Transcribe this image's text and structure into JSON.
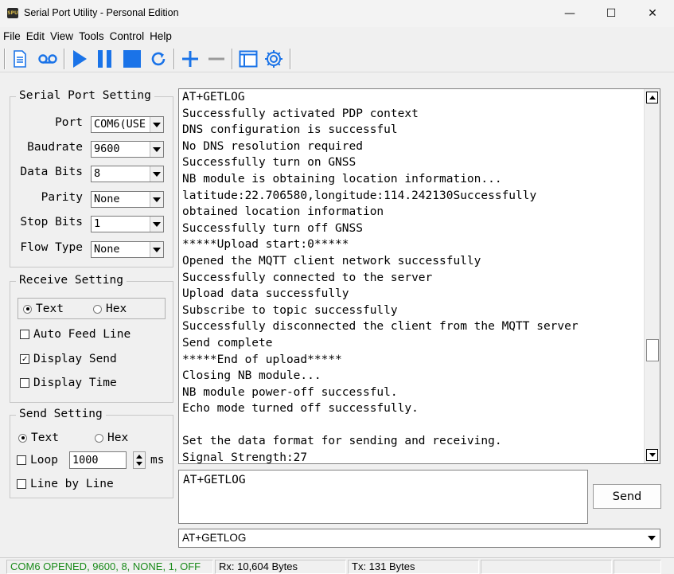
{
  "window": {
    "title": "Serial Port Utility - Personal Edition",
    "icon_text": "SPU",
    "minimize_glyph": "—",
    "maximize_glyph": "☐",
    "close_glyph": "✕"
  },
  "menu": [
    "File",
    "Edit",
    "View",
    "Tools",
    "Control",
    "Help"
  ],
  "toolbar": {
    "buttons": [
      "new-file-icon",
      "record-icon",
      "play-icon",
      "pause-icon",
      "stop-icon",
      "refresh-icon",
      "plus-icon",
      "minus-icon",
      "window-icon",
      "gear-icon"
    ],
    "accent": "#1a73e8"
  },
  "serial_port_setting": {
    "title": "Serial Port Setting",
    "port": {
      "label": "Port",
      "value": "COM6(USE"
    },
    "baudrate": {
      "label": "Baudrate",
      "value": "9600"
    },
    "data_bits": {
      "label": "Data Bits",
      "value": "8"
    },
    "parity": {
      "label": "Parity",
      "value": "None"
    },
    "stop_bits": {
      "label": "Stop Bits",
      "value": "1"
    },
    "flow_type": {
      "label": "Flow Type",
      "value": "None"
    }
  },
  "receive_setting": {
    "title": "Receive Setting",
    "text_label": "Text",
    "hex_label": "Hex",
    "text_selected": true,
    "auto_feed_line": {
      "label": "Auto Feed Line",
      "checked": false
    },
    "display_send": {
      "label": "Display Send",
      "checked": true
    },
    "display_time": {
      "label": "Display Time",
      "checked": false
    }
  },
  "send_setting": {
    "title": "Send Setting",
    "text_label": "Text",
    "hex_label": "Hex",
    "text_selected": true,
    "loop": {
      "label": "Loop",
      "checked": false,
      "interval": "1000",
      "unit": "ms"
    },
    "line_by_line": {
      "label": "Line by Line",
      "checked": false
    }
  },
  "log_lines": [
    "AT+GETLOG",
    "Successfully activated PDP context",
    "DNS configuration is successful",
    "No DNS resolution required",
    "Successfully turn on GNSS",
    "NB module is obtaining location information...",
    "latitude:22.706580,longitude:114.242130Successfully",
    "obtained location information",
    "Successfully turn off GNSS",
    "*****Upload start:0*****",
    "Opened the MQTT client network successfully",
    "Successfully connected to the server",
    "Upload data successfully",
    "Subscribe to topic successfully",
    "Successfully disconnected the client from the MQTT server",
    "Send complete",
    "*****End of upload*****",
    "Closing NB module...",
    "NB module power-off successful.",
    "Echo mode turned off successfully.",
    "",
    "Set the data format for sending and receiving.",
    "Signal Strength:27"
  ],
  "send": {
    "input_value": "AT+GETLOG",
    "button_label": "Send",
    "history_value": "AT+GETLOG"
  },
  "status": {
    "connection": "COM6 OPENED, 9600, 8, NONE, 1, OFF",
    "connection_color": "#1a8a1a",
    "rx": "Rx: 10,604 Bytes",
    "tx": "Tx: 131 Bytes"
  }
}
